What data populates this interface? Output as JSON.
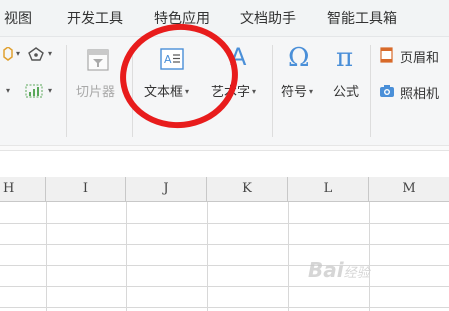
{
  "menu": {
    "items": [
      "视图",
      "开发工具",
      "特色应用",
      "文档助手",
      "智能工具箱"
    ]
  },
  "ribbon": {
    "slicer_label": "切片器",
    "textbox_label": "文本框",
    "wordart_label": "艺术字",
    "symbol_label": "符号",
    "formula_label": "公式",
    "header_footer_label": "页眉和",
    "camera_label": "照相机",
    "dropdown_glyph": "▾",
    "symbol_glyph": "Ω",
    "formula_glyph": "π"
  },
  "sheet": {
    "columns": [
      "H",
      "I",
      "J",
      "K",
      "L",
      "M"
    ]
  },
  "watermark": {
    "brand": "Bai",
    "suffix": "经验"
  },
  "colors": {
    "annotation": "#e81c1c",
    "icon_blue": "#4a8fd8",
    "menubar_bg": "#f2f4f5",
    "ribbon_bg": "#f5f6f7"
  },
  "icons": [
    "gem-icon",
    "pentagon-icon",
    "chart-icon",
    "slicer-icon",
    "textbox-icon",
    "wordart-icon",
    "omega-icon",
    "pi-icon",
    "header-footer-icon",
    "camera-icon"
  ]
}
